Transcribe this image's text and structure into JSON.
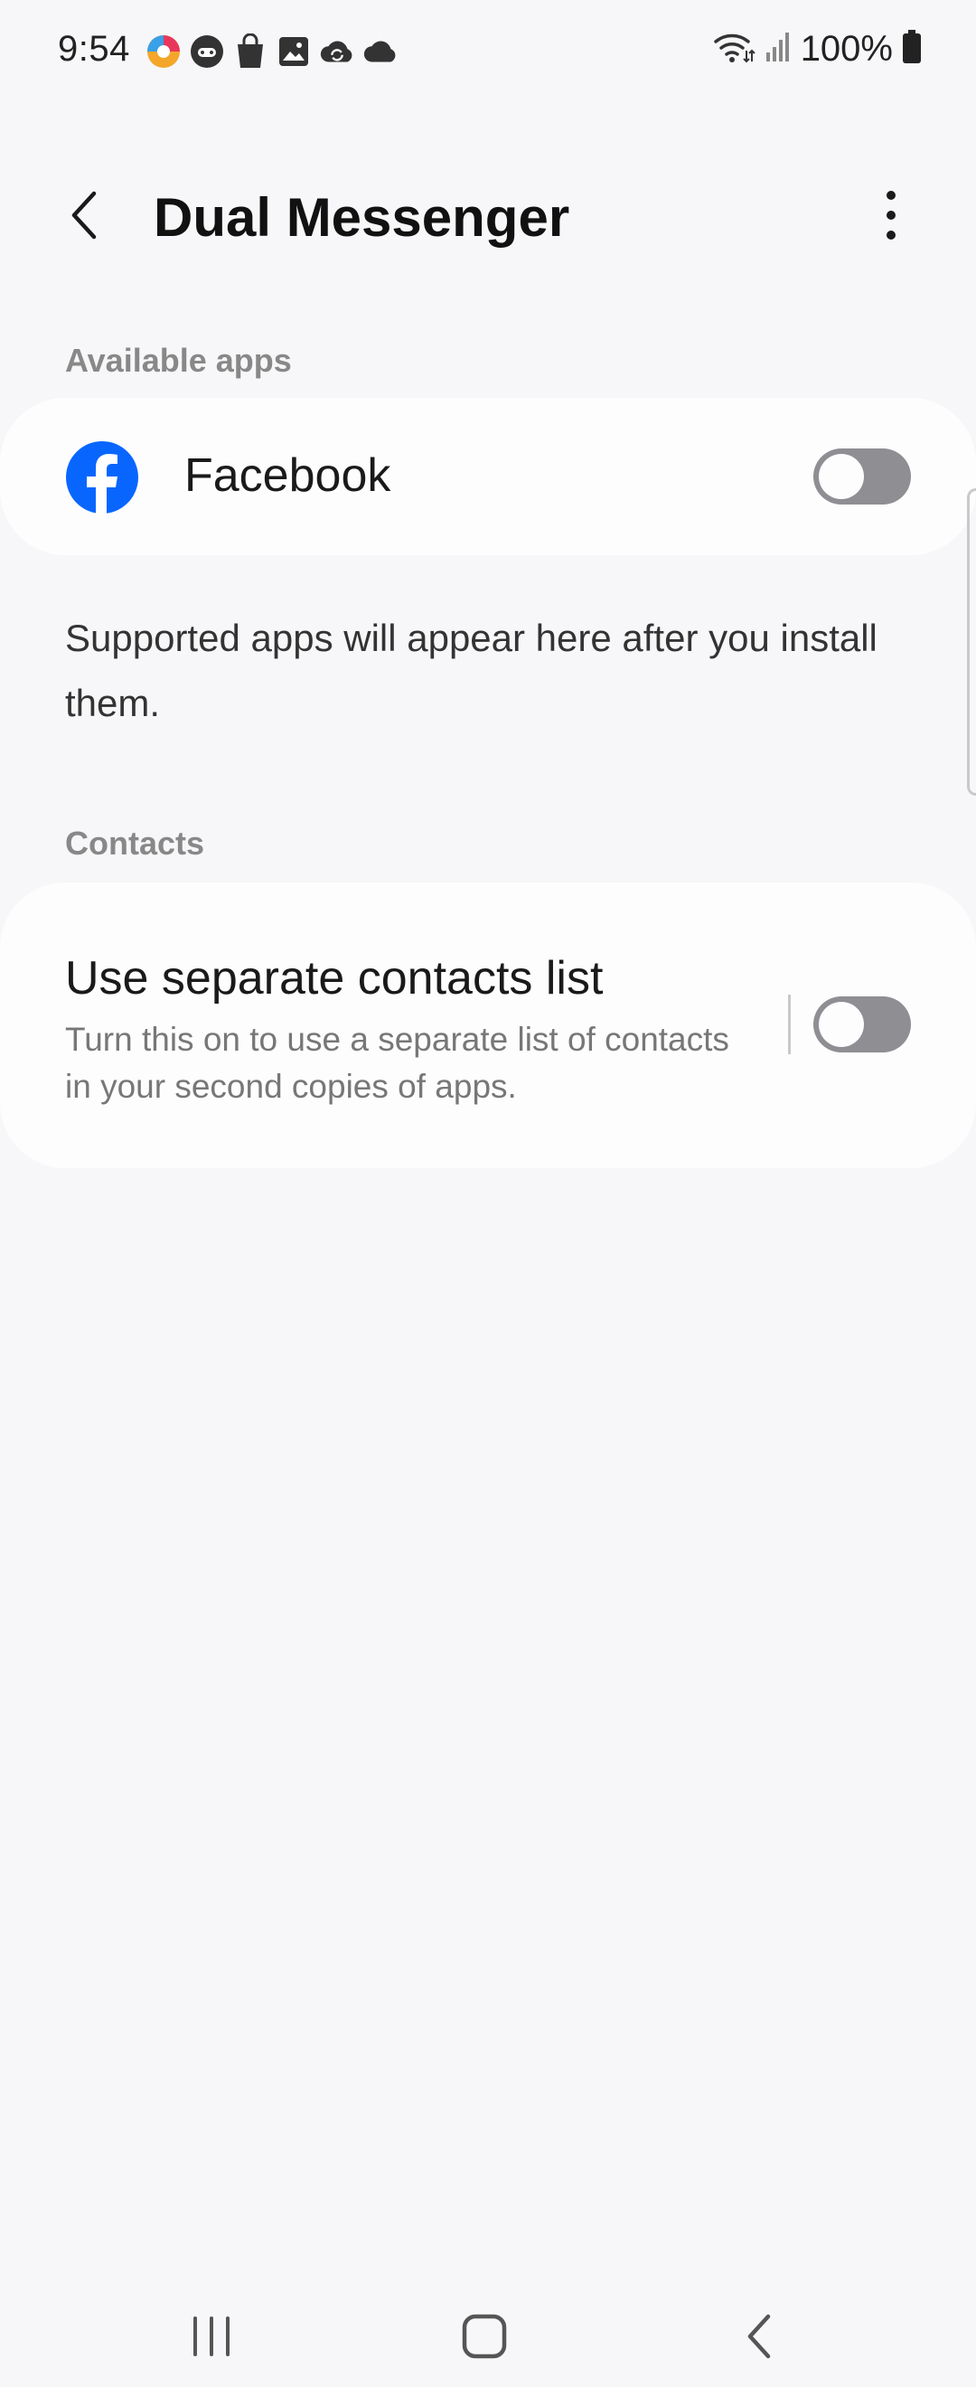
{
  "status_bar": {
    "time": "9:54",
    "battery_text": "100%",
    "notification_icons": [
      "browser-icon",
      "game-icon",
      "shopping-bag-icon",
      "gallery-icon",
      "cloud-sync-icon",
      "cloud-icon"
    ],
    "right_icons": [
      "wifi-icon",
      "signal-icon",
      "battery-icon"
    ]
  },
  "app_bar": {
    "title": "Dual Messenger",
    "back_icon": "back-arrow-icon",
    "more_icon": "more-vertical-icon"
  },
  "sections": {
    "available_apps": {
      "header": "Available apps",
      "apps": [
        {
          "label": "Facebook",
          "icon": "facebook-icon",
          "enabled": false
        }
      ],
      "info": "Supported apps will appear here after you install them."
    },
    "contacts": {
      "header": "Contacts",
      "title": "Use separate contacts list",
      "description": "Turn this on to use a separate list of contacts in your second copies of apps.",
      "enabled": false
    }
  },
  "nav_bar": {
    "items": [
      "recents-icon",
      "home-icon",
      "back-icon"
    ]
  },
  "colors": {
    "background": "#f7f7f9",
    "card": "#fdfdfe",
    "toggle_off": "#8e8e93",
    "facebook_blue": "#0866ff",
    "section_header": "#888888"
  }
}
